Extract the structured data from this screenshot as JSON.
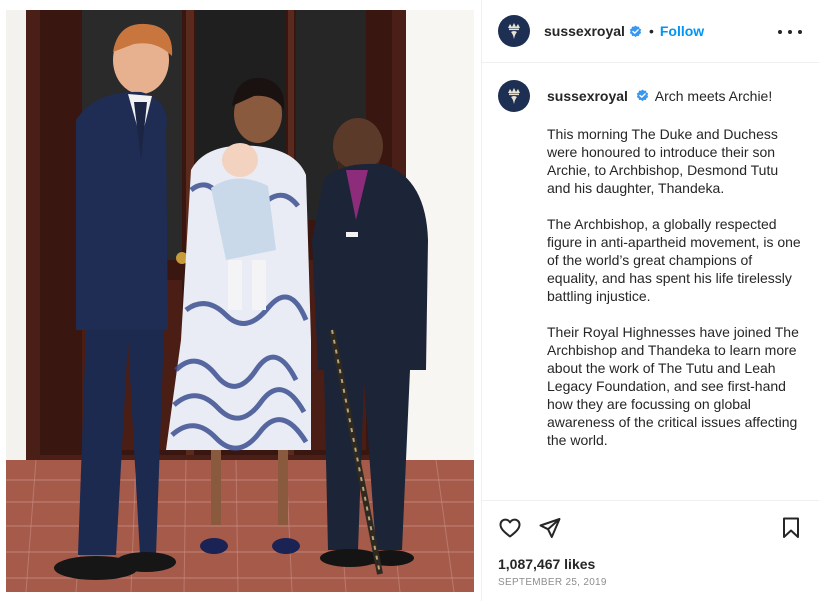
{
  "post": {
    "username": "sussexroyal",
    "follow_label": "Follow",
    "separator": "•",
    "caption_title": "Arch meets Archie!",
    "paragraphs": [
      "This morning The Duke and Duchess were honoured to introduce their son Archie, to Archbishop, Desmond Tutu and his daughter, Thandeka.",
      "The Archbishop, a globally respected figure in anti-apartheid movement, is one of the world’s great champions of equality, and has spent his life tirelessly battling injustice.",
      "Their Royal Highnesses have joined The Archbishop and Thandeka to learn more about the work of The Tutu and Leah Legacy Foundation, and see first-hand how they are focussing on global awareness of the critical issues affecting the world."
    ],
    "likes": "1,087,467 likes",
    "date": "September 25, 2019"
  },
  "icons": {
    "avatar": "royal-crest-icon",
    "verified": "verified-badge-icon",
    "more": "more-options-icon",
    "like": "heart-icon",
    "share": "paper-plane-icon",
    "save": "bookmark-icon"
  },
  "colors": {
    "follow_blue": "#0095f6",
    "verified_blue": "#3897f0",
    "avatar_navy": "#1d2f52",
    "meta_gray": "#8e8e8e",
    "divider": "#efefef"
  }
}
